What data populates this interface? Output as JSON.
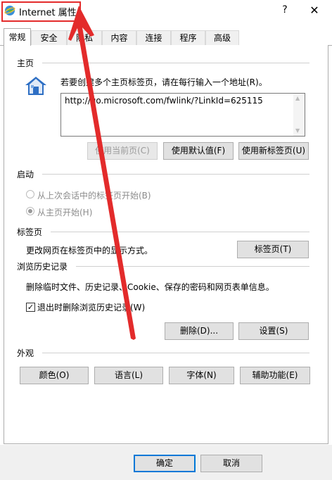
{
  "window": {
    "title": "Internet 属性",
    "help": "?",
    "close": "✕"
  },
  "tabs": [
    {
      "label": "常规",
      "active": true
    },
    {
      "label": "安全"
    },
    {
      "label": "隐私"
    },
    {
      "label": "内容"
    },
    {
      "label": "连接"
    },
    {
      "label": "程序"
    },
    {
      "label": "高级"
    }
  ],
  "home": {
    "title": "主页",
    "instruction": "若要创建多个主页标签页，请在每行输入一个地址(R)。",
    "url": "http://go.microsoft.com/fwlink/?LinkId=625115",
    "btn_current": "使用当前页(C)",
    "btn_default": "使用默认值(F)",
    "btn_newtab": "使用新标签页(U)"
  },
  "startup": {
    "title": "启动",
    "option_last": "从上次会话中的标签页开始(B)",
    "option_home": "从主页开始(H)"
  },
  "tabs_section": {
    "title": "标签页",
    "desc": "更改网页在标签页中的显示方式。",
    "btn": "标签页(T)"
  },
  "history": {
    "title": "浏览历史记录",
    "desc": "删除临时文件、历史记录、Cookie、保存的密码和网页表单信息。",
    "checkbox_label": "退出时删除浏览历史记录(W)",
    "checked": true,
    "btn_delete": "删除(D)...",
    "btn_settings": "设置(S)"
  },
  "appearance": {
    "title": "外观",
    "btn_colors": "颜色(O)",
    "btn_language": "语言(L)",
    "btn_fonts": "字体(N)",
    "btn_access": "辅助功能(E)"
  },
  "footer": {
    "ok": "确定",
    "cancel": "取消"
  },
  "colors": {
    "annotation": "#e32b2b",
    "button_bg": "#e1e1e1",
    "border": "#adadad"
  }
}
